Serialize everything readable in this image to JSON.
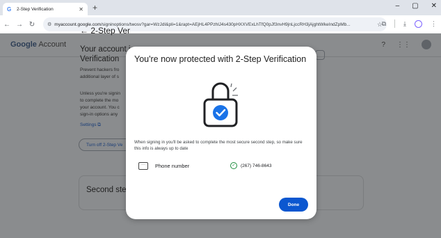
{
  "browser": {
    "tab_title": "2-Step Verification",
    "tab_favicon": "G",
    "url_host": "myaccount.google.com",
    "url_path": "/signinoptions/twosv?gar=WzJdI&pli=1&rapt=AEjHL4PPzhlJ4s430pHXXVExLhTfQ0pJf3nvH9jnLjccRH3jAjghtWkeIndZpMb..."
  },
  "header": {
    "logo_google": "Google",
    "logo_account": "Account"
  },
  "background": {
    "back_title": "2-Step Ver",
    "heading": "Your account i\nVerification",
    "para1": "Prevent hackers fro\nadditional layer of s",
    "para2": "Unless you're signin\nto complete the mo\nyour account. You c\nsign-in options any",
    "settings_link": "Settings",
    "turn_off_btn": "Turn off 2-Step Ve",
    "second_steps": "Second steps"
  },
  "dialog": {
    "title": "You're now protected with 2-Step Verification",
    "body": "When signing in you'll be asked to complete the most secure second step, so make sure this info is always up to date",
    "phone_label": "Phone number",
    "phone_value": "(267) 746-8643",
    "done_label": "Done"
  },
  "colors": {
    "accent": "#0b57d0",
    "success": "#1e8e3e",
    "lock_badge": "#1a73e8"
  },
  "icons": [
    "google-favicon-icon",
    "close-icon",
    "plus-icon",
    "back-icon",
    "forward-icon",
    "reload-icon",
    "site-info-icon",
    "star-icon",
    "extensions-icon",
    "download-icon",
    "profile-icon",
    "menu-icon",
    "help-icon",
    "apps-icon",
    "lock-check-icon",
    "message-icon",
    "check-circle-icon"
  ]
}
